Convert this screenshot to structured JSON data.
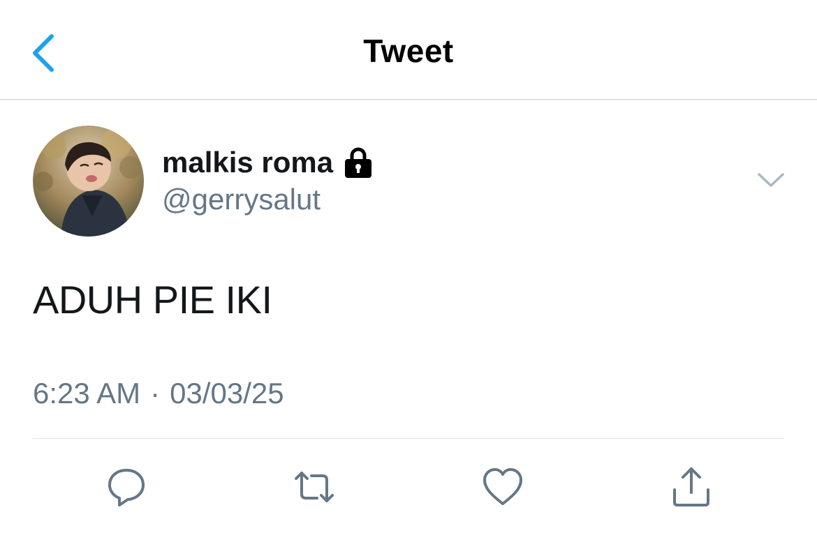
{
  "navbar": {
    "title": "Tweet",
    "back_icon": "chevron-left-icon",
    "accent_color": "#1da1f2"
  },
  "tweet": {
    "author": {
      "display_name": "malkis roma",
      "handle": "@gerrysalut",
      "protected_icon": "lock-icon"
    },
    "text": "ADUH PIE IKI",
    "time": "6:23 AM",
    "separator": "·",
    "date": "03/03/25",
    "menu_icon": "chevron-down-icon"
  },
  "actions": [
    {
      "name": "reply",
      "icon": "reply-icon"
    },
    {
      "name": "retweet",
      "icon": "retweet-icon"
    },
    {
      "name": "like",
      "icon": "heart-icon"
    },
    {
      "name": "share",
      "icon": "share-icon"
    }
  ],
  "colors": {
    "text_primary": "#14171a",
    "text_secondary": "#657786",
    "icon_gray": "#657786",
    "divider": "#dfe3e6"
  }
}
